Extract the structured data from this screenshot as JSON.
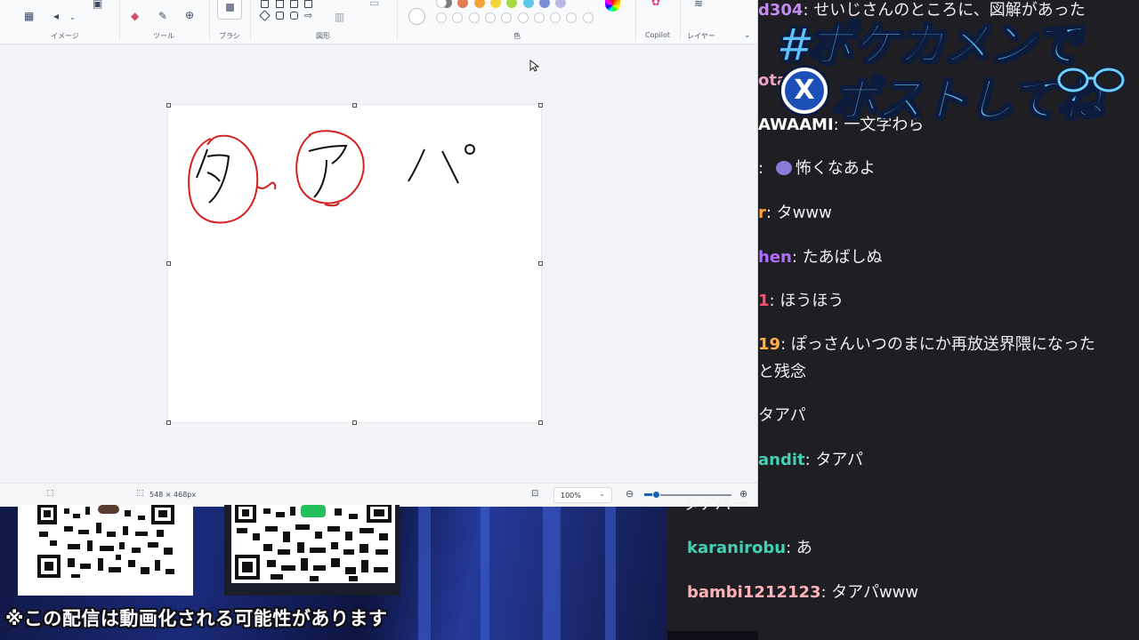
{
  "paint": {
    "groups": {
      "image": "イメージ",
      "tools": "ツール",
      "brushes": "ブラシ",
      "shapes": "図形",
      "colors": "色",
      "copilot": "Copilot",
      "layers": "レイヤー"
    },
    "palette": [
      "#7c7c7c",
      "#e07b55",
      "#f4a13a",
      "#f5d235",
      "#a8d843",
      "#5ec8e8",
      "#7d8ed8",
      "#b9b9e8"
    ],
    "canvas": {
      "drawn_chars": [
        "タ",
        "ア",
        "パ"
      ],
      "stroke_color": "#111111",
      "circle_color": "#d42020"
    },
    "status": {
      "size": "548 × 468px",
      "zoom": "100%"
    }
  },
  "stream": {
    "disclaimer": "※この配信は動画化される可能性があります",
    "hashtag_line1": "#ポケカメンで",
    "hashtag_line2": "ポストしてね",
    "x_badge": "X"
  },
  "chat": {
    "messages": [
      {
        "user": "d304",
        "user_color": "#c48bf2",
        "text": ": せいじさんのところに、図解があった"
      },
      {
        "user": "ota",
        "user_color": "#e8a3c6",
        "text": ""
      },
      {
        "user": "AWAAMI",
        "user_color": "#ffffff",
        "text": ": 一文字わら"
      },
      {
        "user": "",
        "user_color": "#ffffff",
        "text": ": ",
        "emote": true,
        "text2": "怖くなあよ"
      },
      {
        "user": "r",
        "user_color": "#ff9f2e",
        "text": ": タwww"
      },
      {
        "user": "hen",
        "user_color": "#b06fff",
        "text": ": たあばしぬ"
      },
      {
        "user": "1",
        "user_color": "#ff4f6e",
        "text": ": ほうほう"
      },
      {
        "user": "19",
        "user_color": "#ffb04a",
        "text": ": ぽっさんいつのまにか再放送界隈になった"
      },
      {
        "user": "",
        "user_color": "#ffffff",
        "text": "と残念"
      },
      {
        "user": "",
        "user_color": "#ffffff",
        "text": "タアパ"
      },
      {
        "user": "andit",
        "user_color": "#43d0b3",
        "text": ": タアパ"
      },
      {
        "user": "",
        "user_color": "#ffffff",
        "text": "タアパー"
      },
      {
        "user": "karanirobu",
        "user_color": "#43d0b3",
        "text": ": あ"
      },
      {
        "user": "bambi1212123",
        "user_color": "#ffb3b8",
        "text": ": タアパwww"
      }
    ]
  }
}
